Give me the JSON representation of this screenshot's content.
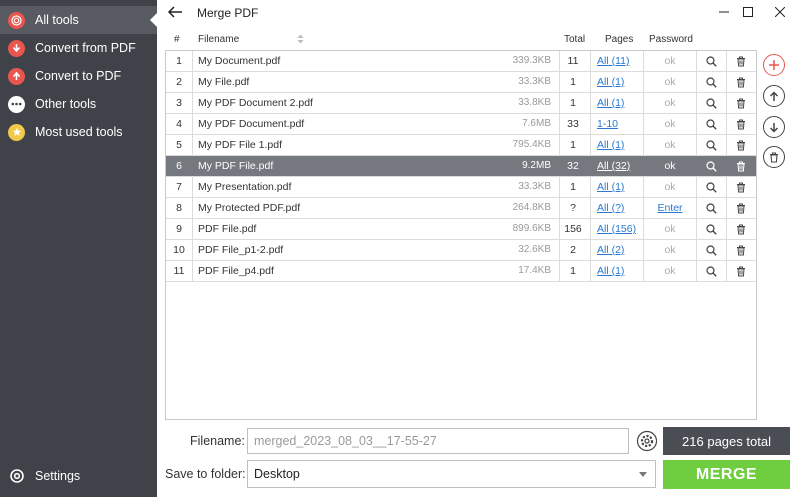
{
  "sidebar": {
    "items": [
      {
        "label": "All tools",
        "icon": "all-tools-icon"
      },
      {
        "label": "Convert from PDF",
        "icon": "convert-from-pdf-icon"
      },
      {
        "label": "Convert to PDF",
        "icon": "convert-to-pdf-icon"
      },
      {
        "label": "Other tools",
        "icon": "other-tools-icon"
      },
      {
        "label": "Most used tools",
        "icon": "star-icon"
      }
    ],
    "settings_label": "Settings"
  },
  "window": {
    "title": "Merge PDF"
  },
  "table": {
    "headers": {
      "num": "#",
      "filename": "Filename",
      "total": "Total",
      "pages": "Pages",
      "password": "Password"
    },
    "rows": [
      {
        "num": "1",
        "name": "My Document.pdf",
        "size": "339.3KB",
        "total": "11",
        "pages": "All (11)",
        "password": "ok"
      },
      {
        "num": "2",
        "name": "My File.pdf",
        "size": "33.3KB",
        "total": "1",
        "pages": "All (1)",
        "password": "ok"
      },
      {
        "num": "3",
        "name": "My PDF Document 2.pdf",
        "size": "33.8KB",
        "total": "1",
        "pages": "All (1)",
        "password": "ok"
      },
      {
        "num": "4",
        "name": "My PDF Document.pdf",
        "size": "7.6MB",
        "total": "33",
        "pages": "1-10",
        "password": "ok"
      },
      {
        "num": "5",
        "name": "My PDF File 1.pdf",
        "size": "795.4KB",
        "total": "1",
        "pages": "All (1)",
        "password": "ok"
      },
      {
        "num": "6",
        "name": "My PDF File.pdf",
        "size": "9.2MB",
        "total": "32",
        "pages": "All (32)",
        "password": "ok"
      },
      {
        "num": "7",
        "name": "My Presentation.pdf",
        "size": "33.3KB",
        "total": "1",
        "pages": "All (1)",
        "password": "ok"
      },
      {
        "num": "8",
        "name": "My Protected PDF.pdf",
        "size": "264.8KB",
        "total": "?",
        "pages": "All (?)",
        "password": "Enter"
      },
      {
        "num": "9",
        "name": "PDF File.pdf",
        "size": "899.6KB",
        "total": "156",
        "pages": "All (156)",
        "password": "ok"
      },
      {
        "num": "10",
        "name": "PDF File_p1-2.pdf",
        "size": "32.6KB",
        "total": "2",
        "pages": "All (2)",
        "password": "ok"
      },
      {
        "num": "11",
        "name": "PDF File_p4.pdf",
        "size": "17.4KB",
        "total": "1",
        "pages": "All (1)",
        "password": "ok"
      }
    ]
  },
  "bottom": {
    "filename_label": "Filename:",
    "filename_value": "merged_2023_08_03__17-55-27",
    "save_label": "Save to folder:",
    "folder_value": "Desktop",
    "total_pages": "216 pages total",
    "merge_label": "MERGE"
  },
  "colors": {
    "sidebar_bg": "#3f4349",
    "selected_row": "#75787e",
    "merge_green": "#6fce3f",
    "accent_red": "#e8564f",
    "link_blue": "#2a7ad2"
  }
}
